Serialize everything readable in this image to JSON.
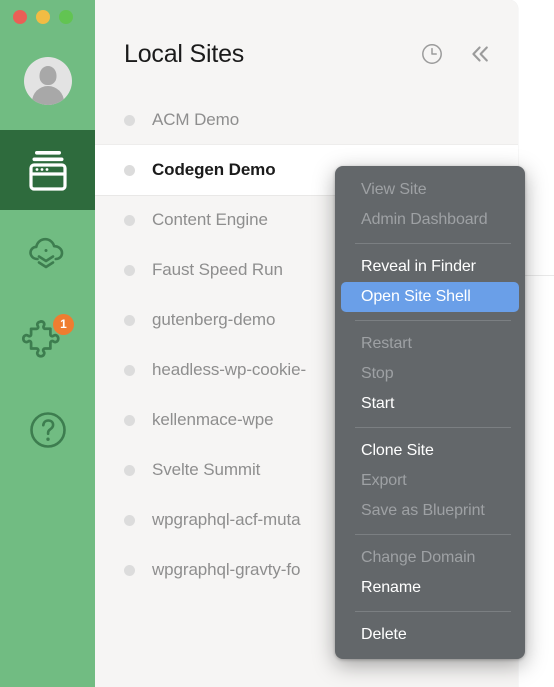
{
  "window": {
    "traffic_lights": [
      {
        "name": "close",
        "color": "#ea5f56"
      },
      {
        "name": "minimize",
        "color": "#f2bc44"
      },
      {
        "name": "maximize",
        "color": "#62c452"
      }
    ]
  },
  "rail": {
    "background": "#71bc82",
    "active_background": "#2e6b3d",
    "avatar_label": "User avatar",
    "items": [
      {
        "id": "sites",
        "icon": "sites-icon",
        "label": "Local Sites",
        "active": true,
        "badge": null
      },
      {
        "id": "cloud",
        "icon": "cloud-icon",
        "label": "Cloud Backups",
        "active": false,
        "badge": null
      },
      {
        "id": "addons",
        "icon": "puzzle-icon",
        "label": "Add-ons",
        "active": false,
        "badge": "1"
      },
      {
        "id": "help",
        "icon": "help-icon",
        "label": "Help",
        "active": false,
        "badge": null
      }
    ],
    "badge_color": "#ef7d30"
  },
  "header": {
    "title": "Local Sites",
    "actions": [
      {
        "id": "history",
        "icon": "clock-icon",
        "label": "History"
      },
      {
        "id": "collapse",
        "icon": "double-chevron-left-icon",
        "label": "Collapse sidebar"
      }
    ]
  },
  "sites": {
    "status_dot_color": "#dcdcdc",
    "items": [
      {
        "name": "ACM Demo",
        "selected": false
      },
      {
        "name": "Codegen Demo",
        "selected": true
      },
      {
        "name": "Content Engine",
        "selected": false
      },
      {
        "name": "Faust Speed Run",
        "selected": false
      },
      {
        "name": "gutenberg-demo",
        "selected": false
      },
      {
        "name": "headless-wp-cookie-",
        "selected": false
      },
      {
        "name": "kellenmace-wpe",
        "selected": false
      },
      {
        "name": "Svelte Summit",
        "selected": false
      },
      {
        "name": "wpgraphql-acf-muta",
        "selected": false
      },
      {
        "name": "wpgraphql-gravty-fo",
        "selected": false
      }
    ]
  },
  "context_menu": {
    "background": "#63676a",
    "highlight_color": "#6a9fe8",
    "groups": [
      [
        {
          "label": "View Site",
          "state": "disabled"
        },
        {
          "label": "Admin Dashboard",
          "state": "disabled"
        }
      ],
      [
        {
          "label": "Reveal in Finder",
          "state": "enabled"
        },
        {
          "label": "Open Site Shell",
          "state": "highlighted"
        }
      ],
      [
        {
          "label": "Restart",
          "state": "disabled"
        },
        {
          "label": "Stop",
          "state": "disabled"
        },
        {
          "label": "Start",
          "state": "enabled"
        }
      ],
      [
        {
          "label": "Clone Site",
          "state": "enabled"
        },
        {
          "label": "Export",
          "state": "disabled"
        },
        {
          "label": "Save as Blueprint",
          "state": "disabled"
        }
      ],
      [
        {
          "label": "Change Domain",
          "state": "disabled"
        },
        {
          "label": "Rename",
          "state": "enabled"
        }
      ],
      [
        {
          "label": "Delete",
          "state": "enabled"
        }
      ]
    ]
  }
}
